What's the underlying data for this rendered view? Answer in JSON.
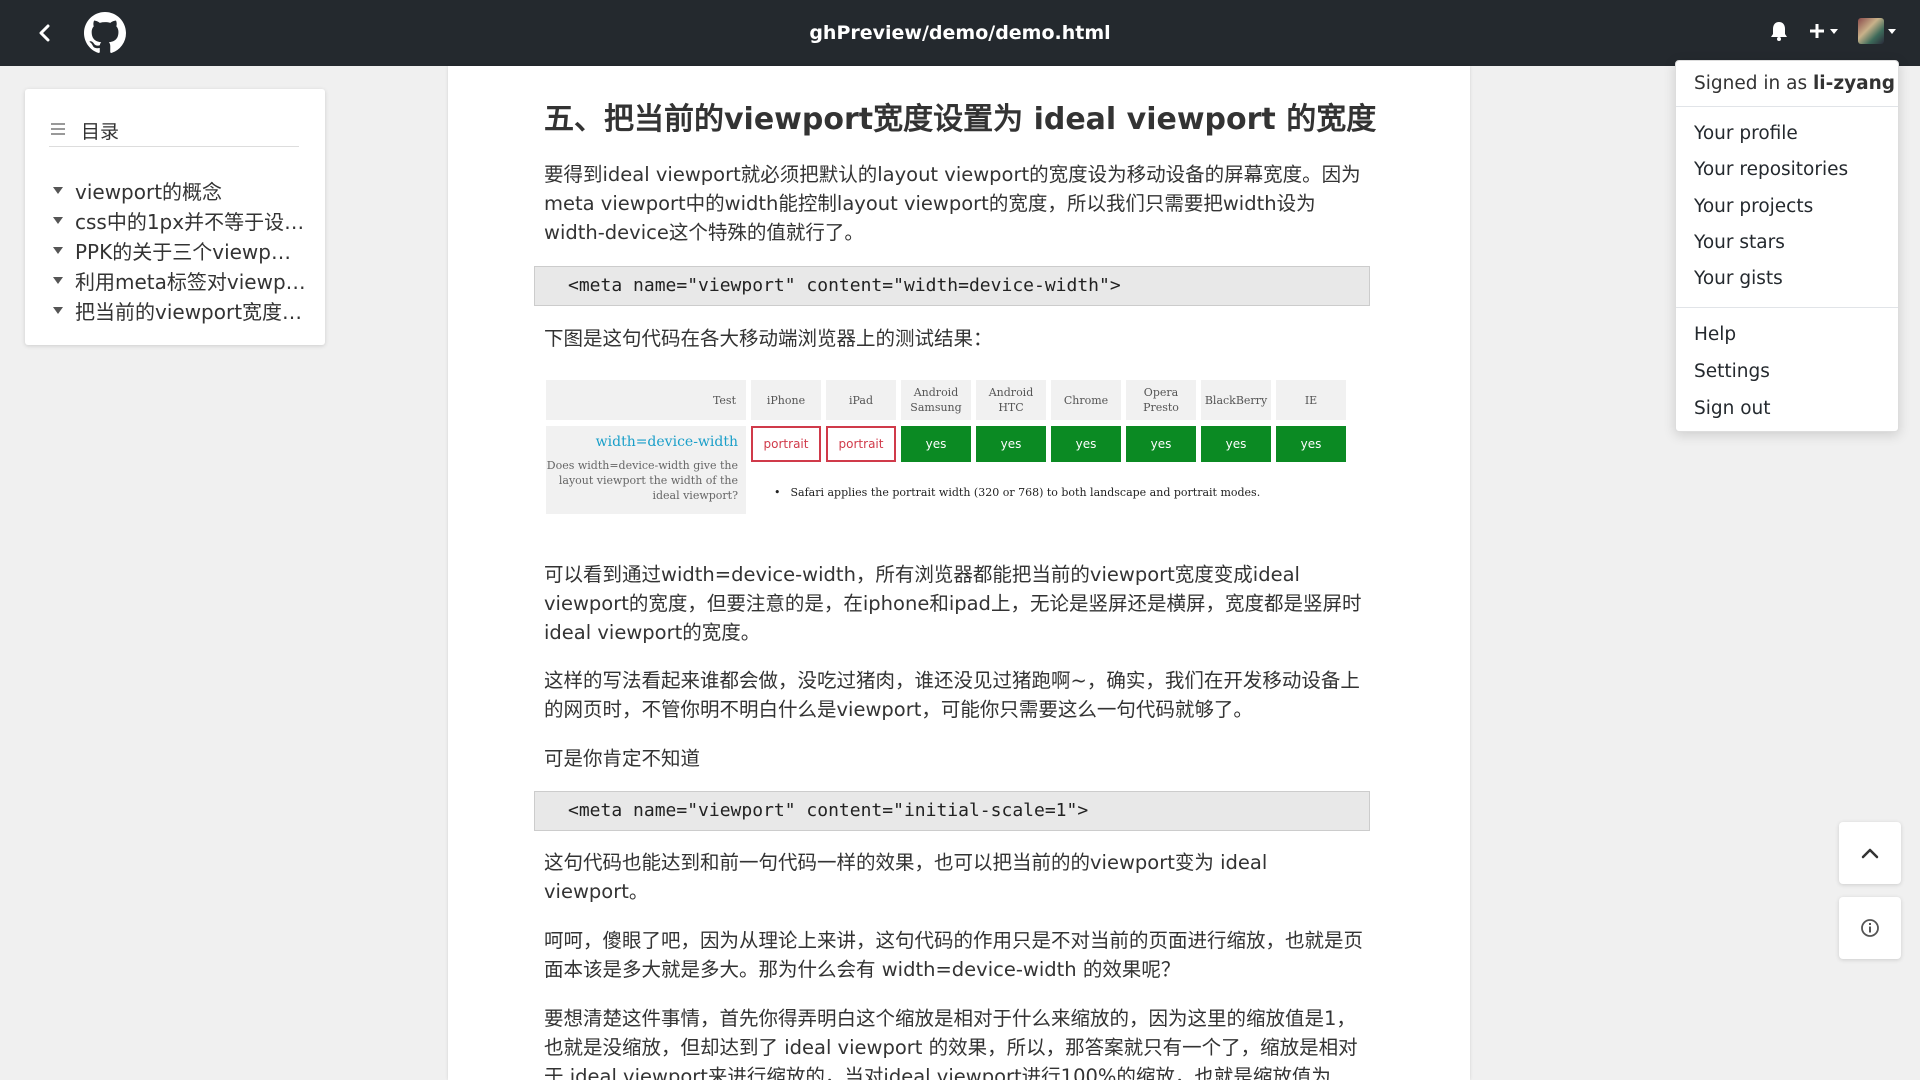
{
  "header": {
    "path": "ghPreview/demo/demo.html",
    "icons": [
      "back-arrow-icon",
      "github-logo-icon",
      "bell-icon",
      "plus-icon",
      "avatar"
    ]
  },
  "toc": {
    "title": "目录",
    "items": [
      "viewport的概念",
      "css中的1px并不等于设…",
      "PPK的关于三个viewp…",
      "利用meta标签对viewp…",
      "把当前的viewport宽度…"
    ]
  },
  "article": {
    "heading": "五、把当前的viewport宽度设置为 ideal viewport 的宽度",
    "para1": "要得到ideal viewport就必须把默认的layout viewport的宽度设为移动设备的屏幕宽度。因为meta viewport中的width能控制layout viewport的宽度，所以我们只需要把width设为width-device这个特殊的值就行了。",
    "code1": "<meta name=\"viewport\" content=\"width=device-width\">",
    "para2": "下图是这句代码在各大移动端浏览器上的测试结果：",
    "table": {
      "headers": [
        "Test",
        "iPhone",
        "iPad",
        "Android Samsung",
        "Android HTC",
        "Chrome",
        "Opera Presto",
        "BlackBerry",
        "IE"
      ],
      "row_label": "width=device-width",
      "row_desc": "Does width=device-width give the layout viewport the width of the ideal viewport?",
      "results": [
        "portrait",
        "portrait",
        "yes",
        "yes",
        "yes",
        "yes",
        "yes",
        "yes"
      ],
      "note": "Safari applies the portrait width (320 or 768) to both landscape and portrait modes."
    },
    "para3": "可以看到通过width=device-width，所有浏览器都能把当前的viewport宽度变成ideal viewport的宽度，但要注意的是，在iphone和ipad上，无论是竖屏还是横屏，宽度都是竖屏时ideal viewport的宽度。",
    "para4": "这样的写法看起来谁都会做，没吃过猪肉，谁还没见过猪跑啊~，确实，我们在开发移动设备上的网页时，不管你明不明白什么是viewport，可能你只需要这么一句代码就够了。",
    "para5": "可是你肯定不知道",
    "code2": "<meta name=\"viewport\" content=\"initial-scale=1\">",
    "para6": "这句代码也能达到和前一句代码一样的效果，也可以把当前的的viewport变为 ideal viewport。",
    "para7": "呵呵，傻眼了吧，因为从理论上来讲，这句代码的作用只是不对当前的页面进行缩放，也就是页面本该是多大就是多大。那为什么会有 width=device-width 的效果呢？",
    "para8": "要想清楚这件事情，首先你得弄明白这个缩放是相对于什么来缩放的，因为这里的缩放值是1，也就是没缩放，但却达到了 ideal viewport 的效果，所以，那答案就只有一个了，缩放是相对于 ideal viewport来进行缩放的，当对ideal viewport进行100%的缩放，也就是缩放值为"
  },
  "dropdown": {
    "signed_prefix": "Signed in as ",
    "username": "li-zyang",
    "group1": [
      "Your profile",
      "Your repositories",
      "Your projects",
      "Your stars",
      "Your gists"
    ],
    "group2": [
      "Help",
      "Settings",
      "Sign out"
    ]
  },
  "fab": {
    "top_icon": "chevron-up-icon",
    "info_icon": "info-icon"
  }
}
